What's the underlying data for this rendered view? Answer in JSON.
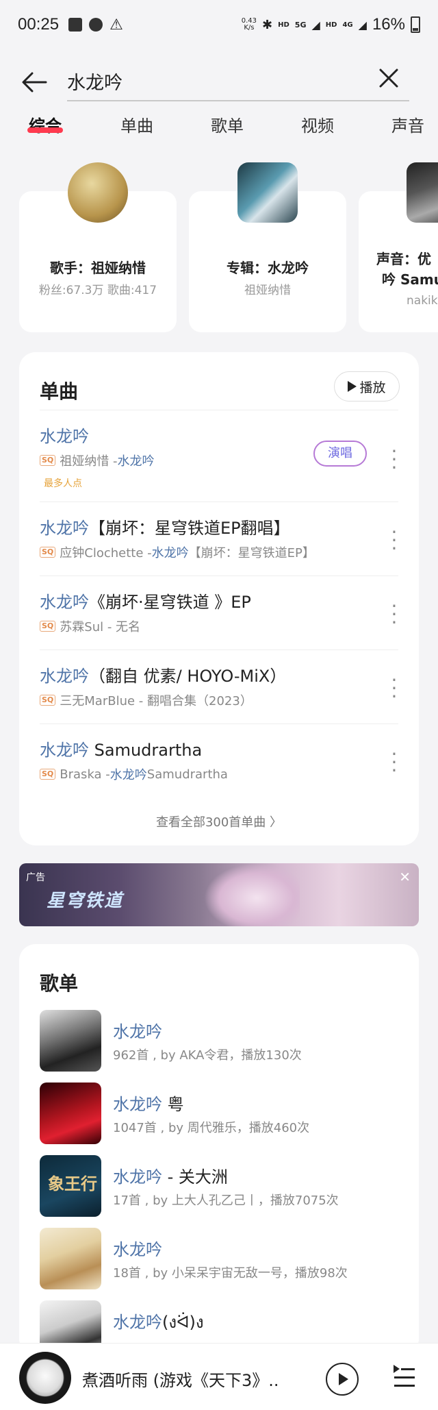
{
  "status": {
    "time": "00:25",
    "speed_value": "0.43",
    "speed_unit": "K/s",
    "battery": "16%",
    "network": "5G",
    "hd1": "HD",
    "hd2": "HD",
    "lte": "4G"
  },
  "search": {
    "query": "水龙吟"
  },
  "tabs": [
    "综合",
    "单曲",
    "歌单",
    "视频",
    "声音"
  ],
  "cards": [
    {
      "title": "歌手：祖娅纳惜",
      "sub": "粉丝:67.3万 歌曲:417"
    },
    {
      "title": "专辑：水龙吟",
      "sub": "祖娅纳惜"
    },
    {
      "title_line1": "声音：优",
      "title_line2": "吟 Samu",
      "sub": "nakik"
    }
  ],
  "songs_section": {
    "title": "单曲",
    "play_label": "播放",
    "view_all": "查看全部300首单曲 〉",
    "sing_label": "演唱",
    "hot_label": "最多人点",
    "quality_badge": "SQ",
    "songs": [
      {
        "name_hl": "水龙吟",
        "name_rest": "",
        "artist": "祖娅纳惜 - ",
        "album_hl": "水龙吟",
        "album_rest": ""
      },
      {
        "name_hl": "水龙吟",
        "name_rest": "【崩坏：星穹铁道EP翻唱】",
        "artist": "应钟Clochette - ",
        "album_hl": "水龙吟",
        "album_rest": "【崩坏：星穹铁道EP】"
      },
      {
        "name_hl": "水龙吟",
        "name_rest": "《崩坏·星穹铁道 》EP",
        "artist": "苏霖Sul - 无名",
        "album_hl": "",
        "album_rest": ""
      },
      {
        "name_hl": "水龙吟",
        "name_rest": "（翻自 优素/ HOYO-MiX）",
        "artist": "三无MarBlue - 翻唱合集（2023）",
        "album_hl": "",
        "album_rest": ""
      },
      {
        "name_hl": "水龙吟",
        "name_rest": " Samudrartha",
        "artist": "Braska - ",
        "album_hl": "水龙吟",
        "album_rest": " Samudrartha"
      }
    ]
  },
  "ad": {
    "tag": "广告",
    "logo": "星穹铁道",
    "close": "✕"
  },
  "playlists_section": {
    "title": "歌单",
    "items": [
      {
        "name_hl": "水龙吟",
        "name_rest": "",
        "meta": "962首 , by AKA令君，播放130次"
      },
      {
        "name_hl": "水龙吟",
        "name_rest": " 粤",
        "meta": "1047首 , by 周代雅乐，播放460次"
      },
      {
        "name_hl": "水龙吟",
        "name_rest": " - 关大洲",
        "meta": "17首 , by 上大人孔乙己丨，播放7075次"
      },
      {
        "name_hl": "水龙吟",
        "name_rest": "",
        "meta": "18首 , by 小呆呆宇宙无敌一号，播放98次"
      },
      {
        "name_hl": "水龙吟",
        "name_rest": "(งᐛ)ง",
        "meta": ""
      }
    ],
    "cover3_text": "象王行"
  },
  "player": {
    "now_playing": "煮酒听雨 (游戏《天下3》..."
  }
}
